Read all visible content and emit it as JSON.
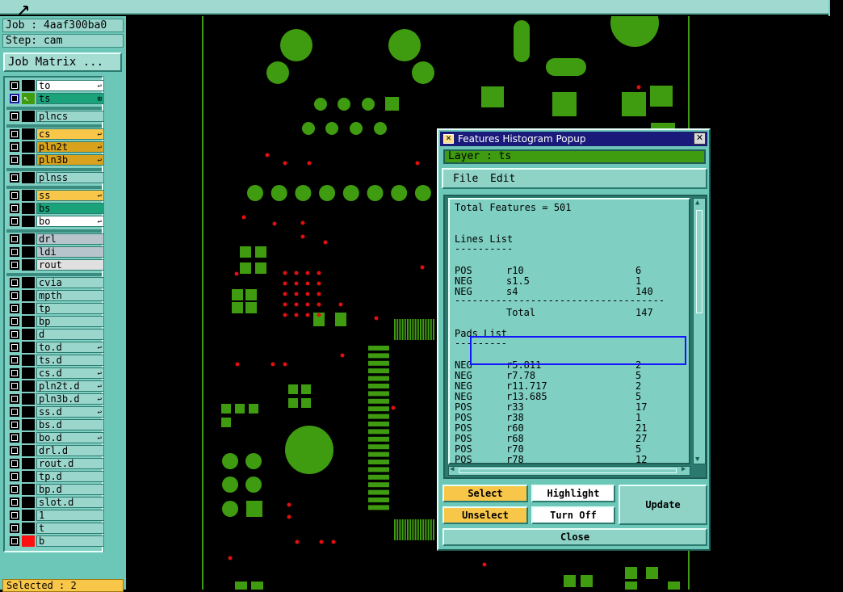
{
  "header": {
    "job": "Job : 4aaf300ba0",
    "step": "Step: cam",
    "job_matrix_button": "Job Matrix ..."
  },
  "layers": [
    {
      "name": "to",
      "color": "#ffffff",
      "flag": "↩"
    },
    {
      "name": "ts",
      "color": "#1aa37a",
      "flag": "⊞",
      "active": true
    },
    {
      "name": "plncs",
      "color": "#9ad6cc",
      "flag": ""
    },
    {
      "name": "cs",
      "color": "#f8c74a",
      "flag": "↩"
    },
    {
      "name": "pln2t",
      "color": "#d9a21c",
      "flag": "↩"
    },
    {
      "name": "pln3b",
      "color": "#d9a21c",
      "flag": "↩"
    },
    {
      "name": "plnss",
      "color": "#9ad6cc",
      "flag": ""
    },
    {
      "name": "ss",
      "color": "#f8c74a",
      "flag": "↩"
    },
    {
      "name": "bs",
      "color": "#1aa37a",
      "flag": ""
    },
    {
      "name": "bo",
      "color": "#ffffff",
      "flag": "↩"
    },
    {
      "name": "drl",
      "color": "#b8c4cc",
      "flag": ""
    },
    {
      "name": "ldi",
      "color": "#b8c4cc",
      "flag": ""
    },
    {
      "name": "rout",
      "color": "#e0e0e0",
      "flag": ""
    },
    {
      "name": "cvia",
      "color": "#9ad6cc",
      "flag": ""
    },
    {
      "name": "mpth",
      "color": "#9ad6cc",
      "flag": ""
    },
    {
      "name": "tp",
      "color": "#9ad6cc",
      "flag": ""
    },
    {
      "name": "bp",
      "color": "#9ad6cc",
      "flag": ""
    },
    {
      "name": "d",
      "color": "#9ad6cc",
      "flag": ""
    },
    {
      "name": "to.d",
      "color": "#9ad6cc",
      "flag": "↩"
    },
    {
      "name": "ts.d",
      "color": "#9ad6cc",
      "flag": ""
    },
    {
      "name": "cs.d",
      "color": "#9ad6cc",
      "flag": "↩"
    },
    {
      "name": "pln2t.d",
      "color": "#9ad6cc",
      "flag": "↩"
    },
    {
      "name": "pln3b.d",
      "color": "#9ad6cc",
      "flag": "↩"
    },
    {
      "name": "ss.d",
      "color": "#9ad6cc",
      "flag": "↩"
    },
    {
      "name": "bs.d",
      "color": "#9ad6cc",
      "flag": ""
    },
    {
      "name": "bo.d",
      "color": "#9ad6cc",
      "flag": "↩"
    },
    {
      "name": "drl.d",
      "color": "#9ad6cc",
      "flag": ""
    },
    {
      "name": "rout.d",
      "color": "#9ad6cc",
      "flag": ""
    },
    {
      "name": "tp.d",
      "color": "#9ad6cc",
      "flag": ""
    },
    {
      "name": "bp.d",
      "color": "#9ad6cc",
      "flag": ""
    },
    {
      "name": "slot.d",
      "color": "#9ad6cc",
      "flag": ""
    },
    {
      "name": "1",
      "color": "#9ad6cc",
      "flag": ""
    },
    {
      "name": "t",
      "color": "#9ad6cc",
      "flag": ""
    },
    {
      "name": "b",
      "color": "#9ad6cc",
      "flag": "",
      "swatch_red": true
    }
  ],
  "status": {
    "selected": "Selected : 2"
  },
  "popup": {
    "title": "Features Histogram Popup",
    "layer_label": "Layer :  ts",
    "menu": {
      "file": "File",
      "edit": "Edit"
    },
    "total": "Total Features = 501",
    "lines_title": "Lines List",
    "lines": [
      {
        "pol": "POS",
        "sym": "r10",
        "count": "6"
      },
      {
        "pol": "NEG",
        "sym": "s1.5",
        "count": "1"
      },
      {
        "pol": "NEG",
        "sym": "s4",
        "count": "140"
      }
    ],
    "lines_total_label": "Total",
    "lines_total": "147",
    "pads_title": "Pads List",
    "pads": [
      {
        "pol": "NEG",
        "sym": "r5.811",
        "count": "2"
      },
      {
        "pol": "NEG",
        "sym": "r7.78",
        "count": "5"
      },
      {
        "pol": "NEG",
        "sym": "r11.717",
        "count": "2"
      },
      {
        "pol": "NEG",
        "sym": "r13.685",
        "count": "5"
      },
      {
        "pol": "POS",
        "sym": "r33",
        "count": "17"
      },
      {
        "pol": "POS",
        "sym": "r38",
        "count": "1"
      },
      {
        "pol": "POS",
        "sym": "r60",
        "count": "21"
      },
      {
        "pol": "POS",
        "sym": "r68",
        "count": "27"
      },
      {
        "pol": "POS",
        "sym": "r70",
        "count": "5"
      },
      {
        "pol": "POS",
        "sym": "r78",
        "count": "12"
      }
    ],
    "buttons": {
      "select": "Select",
      "highlight": "Highlight",
      "update": "Update",
      "unselect": "Unselect",
      "turn_off": "Turn Off",
      "close": "Close"
    }
  },
  "colors": {
    "pcb_green": "#3f9b10",
    "pcb_red": "#e01010",
    "panel_teal": "#6cc7b8"
  }
}
